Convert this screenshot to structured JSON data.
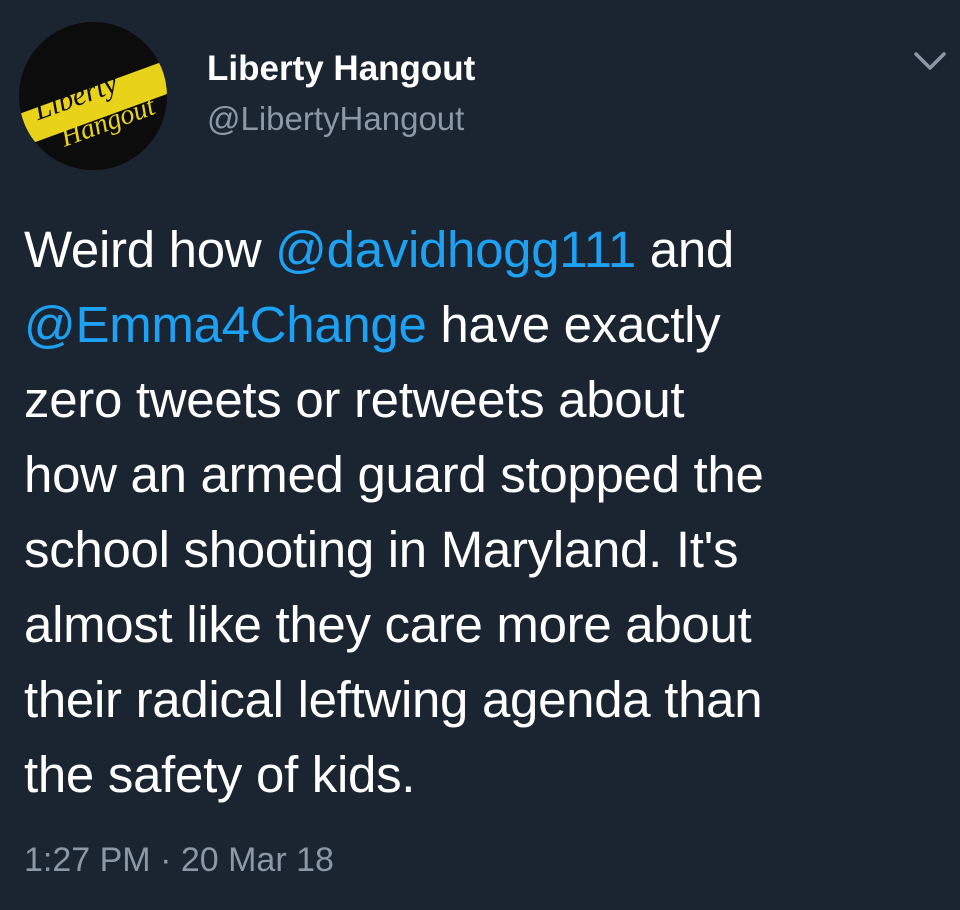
{
  "colors": {
    "background": "#1b2431",
    "text": "#ffffff",
    "secondary_text": "#8b98a6",
    "mention": "#1da1f2",
    "logo_yellow": "#e8d21a"
  },
  "author": {
    "display_name": "Liberty Hangout",
    "handle": "@LibertyHangout",
    "avatar": {
      "icon": "liberty-hangout-logo",
      "logo_text_top": "Liberty",
      "logo_text_bottom": "Hangout"
    }
  },
  "menu": {
    "icon": "chevron-down-icon"
  },
  "tweet": {
    "lines": [
      {
        "parts": [
          {
            "text": "Weird how ",
            "type": "text"
          },
          {
            "text": "@davidhogg111",
            "type": "mention"
          },
          {
            "text": " and",
            "type": "text"
          }
        ]
      },
      {
        "parts": [
          {
            "text": "@Emma4Change",
            "type": "mention"
          },
          {
            "text": " have exactly",
            "type": "text"
          }
        ]
      },
      {
        "parts": [
          {
            "text": "zero tweets or retweets about",
            "type": "text"
          }
        ]
      },
      {
        "parts": [
          {
            "text": "how an armed guard stopped the",
            "type": "text"
          }
        ]
      },
      {
        "parts": [
          {
            "text": "school shooting in Maryland. It's",
            "type": "text"
          }
        ]
      },
      {
        "parts": [
          {
            "text": "almost like they care more about",
            "type": "text"
          }
        ]
      },
      {
        "parts": [
          {
            "text": "their radical leftwing agenda than",
            "type": "text"
          }
        ]
      },
      {
        "parts": [
          {
            "text": "the safety of kids.",
            "type": "text"
          }
        ]
      }
    ],
    "timestamp": "1:27 PM · 20 Mar 18"
  }
}
